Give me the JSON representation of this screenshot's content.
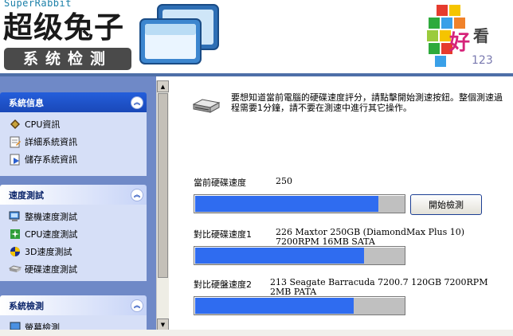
{
  "header": {
    "brand_en": "SuperRabbit",
    "brand_zh": "超级兔子",
    "subtitle": "系统检测",
    "corner_logo_char1": "好",
    "corner_logo_char2": "看",
    "corner_logo_num": "123"
  },
  "sidebar": {
    "panels": [
      {
        "title": "系統信息",
        "items": [
          {
            "label": "CPU資訊",
            "icon": "cpu-chip-icon"
          },
          {
            "label": "詳細系統資訊",
            "icon": "notepad-icon"
          },
          {
            "label": "儲存系統資訊",
            "icon": "save-document-icon"
          }
        ]
      },
      {
        "title": "速度測試",
        "items": [
          {
            "label": "整機速度測試",
            "icon": "computer-icon"
          },
          {
            "label": "CPU速度測試",
            "icon": "cpu-green-icon"
          },
          {
            "label": "3D速度測試",
            "icon": "3d-ball-icon"
          },
          {
            "label": "硬碟速度測試",
            "icon": "hard-disk-icon"
          }
        ]
      },
      {
        "title": "系統檢測",
        "items": [
          {
            "label": "螢幕檢測",
            "icon": "monitor-icon"
          }
        ]
      }
    ]
  },
  "main": {
    "intro": "要想知道當前電腦的硬碟速度評分，請點擊開始測速按鈕。整個測速過程需要1分鐘，請不要在測速中進行其它操作。",
    "current": {
      "label": "當前硬碟速度",
      "value": "250",
      "progress": 0.88
    },
    "start_button": "開始檢測",
    "compare1": {
      "label": "對比硬碟速度1",
      "value": "226   Maxtor 250GB (DiamondMax Plus 10) 7200RPM 16MB SATA",
      "progress": 0.81
    },
    "compare2": {
      "label": "對比硬盤速度2",
      "value": "213   Seagate Barracuda 7200.7 120GB 7200RPM 2MB PATA",
      "progress": 0.76
    }
  },
  "colors": {
    "bar_fill": "#2f6cf0",
    "sidebar_bg": "#6f89c7",
    "panel_header_blue": "#245edb"
  }
}
